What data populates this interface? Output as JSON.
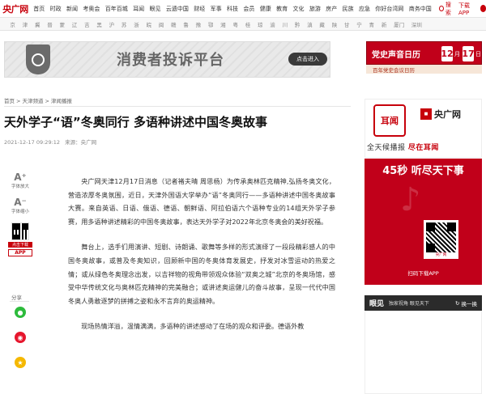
{
  "topbar": {
    "logo": "央广网",
    "nav": [
      "首页",
      "时政",
      "新闻",
      "考奥会",
      "百年百城",
      "耳闻",
      "眼见",
      "云遗中国",
      "财经",
      "军事",
      "科技",
      "会员",
      "健康",
      "教育",
      "文化",
      "旅游",
      "房产",
      "民族",
      "应急",
      "你好台湾网",
      "商务中国"
    ],
    "search_label": "搜索",
    "download_label": "下载APP"
  },
  "cities": [
    "京",
    "津",
    "冀",
    "晋",
    "蒙",
    "辽",
    "吉",
    "黑",
    "沪",
    "苏",
    "浙",
    "皖",
    "闽",
    "赣",
    "鲁",
    "豫",
    "鄂",
    "湘",
    "粤",
    "桂",
    "琼",
    "渝",
    "川",
    "黔",
    "滇",
    "藏",
    "陕",
    "甘",
    "宁",
    "青",
    "新",
    "厦门",
    "深圳"
  ],
  "banner": {
    "title": "消费者投诉平台",
    "button": "点击进入"
  },
  "calendar": {
    "title": "党史声音日历",
    "month": "12",
    "month_unit": "月",
    "day": "17",
    "day_unit": "日",
    "sub": "百年党史会议日历"
  },
  "breadcrumb": [
    "首页",
    "天津频道",
    "津闻播报"
  ],
  "article": {
    "title": "天外学子“语”冬奥同行 多语种讲述中国冬奥故事",
    "datetime": "2021-12-17 09:29:12",
    "source": "来源：央广网",
    "paragraphs": [
      "央广网天津12月17日消息（记者褚夫晴 周思杨）为传承奥林匹克精神,弘扬冬奥文化，营造浓厚冬奥氛围，近日，天津外国语大学举办“语”冬奥同行——多语种讲述中国冬奥故事大赛。来自英语、日语、俄语、德语、朝鲜语、阿拉伯语六个语种专业的14组天外学子参赛，用多语种讲述精彩的中国冬奥故事，表达天外学子对2022年北京冬奥会的美好祝福。",
      "舞台上，选手们用演讲、短剧、诗朗诵、歌舞等多样的形式演绎了一段段精彩感人的中国冬奥故事，或普及冬奥知识，回顾新中国的冬奥体育发展史，抒发对冰雪运动的热爱之情；或从绿色冬奥理念出发，以吉祥物的视角带领观众体验“双奥之城”北京的冬奥场馆，感受中华传统文化与奥林匹克精神的完美融合；或讲述奥运健儿的奋斗故事，呈现一代代中国冬奥人勇敢逐梦的拼搏之姿和永不言弃的奥运精神。",
      "现场热情洋溢，温情满满，多语种的讲述感动了在场的观众和评委。德语外教"
    ]
  },
  "tools": {
    "font_larger": "字体放大",
    "font_smaller": "字体缩小",
    "scan_label": "点击下载",
    "app_tag": "APP",
    "share_label": "分享"
  },
  "ads": {
    "ad1": {
      "seal": "耳闻",
      "app_name": "央广网",
      "slogan_a": "全天候播报",
      "slogan_b": "尽在耳闻"
    },
    "ad2": {
      "title": "45秒 听尽天下事",
      "qr_caption": "央广网",
      "caption": "扫码下载APP"
    }
  },
  "yanjian": {
    "brand": "眼见",
    "tagline": "独家视角 眼见天下",
    "switch": "换一换"
  }
}
